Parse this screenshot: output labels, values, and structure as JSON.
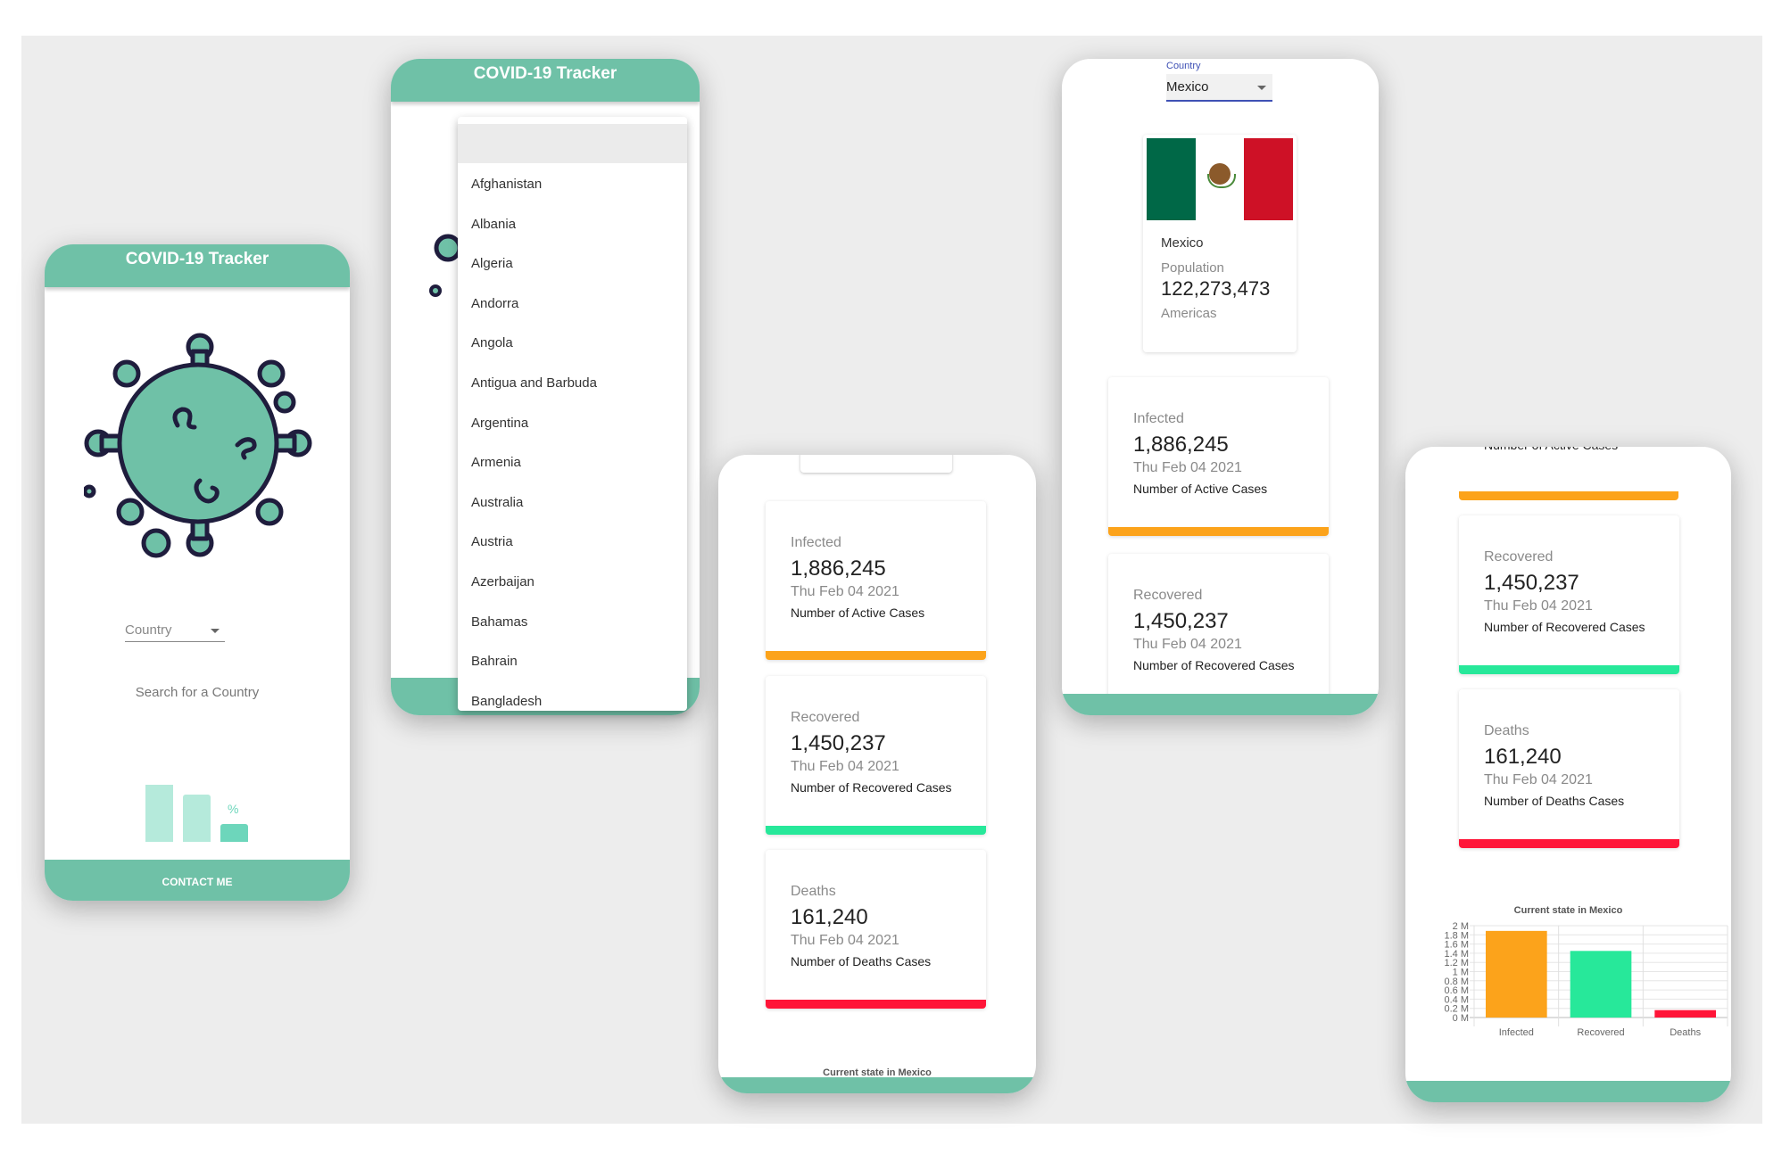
{
  "app": {
    "title": "COVID-19 Tracker",
    "footer": "CONTACT ME"
  },
  "colors": {
    "brand": "#6fc1a7",
    "infected": "#fca31b",
    "recovered": "#27e89a",
    "deaths": "#ff1538",
    "selectFocus": "#3f51b5"
  },
  "home": {
    "select_label": "Country",
    "prompt": "Search for a Country",
    "illustration": "virus-icon",
    "chart_icon": "percent-bars-icon",
    "chart_icon_symbol": "%"
  },
  "dropdown": {
    "countries": [
      "Afghanistan",
      "Albania",
      "Algeria",
      "Andorra",
      "Angola",
      "Antigua and Barbuda",
      "Argentina",
      "Armenia",
      "Australia",
      "Austria",
      "Azerbaijan",
      "Bahamas",
      "Bahrain",
      "Bangladesh"
    ]
  },
  "country": {
    "select_label": "Country",
    "selected": "Mexico",
    "name": "Mexico",
    "population_label": "Population",
    "population": "122,273,473",
    "region": "Americas"
  },
  "stats": [
    {
      "key": "infected",
      "label": "Infected",
      "value": "1,886,245",
      "date": "Thu Feb 04 2021",
      "desc": "Number of Active Cases"
    },
    {
      "key": "recovered",
      "label": "Recovered",
      "value": "1,450,237",
      "date": "Thu Feb 04 2021",
      "desc": "Number of Recovered Cases"
    },
    {
      "key": "deaths",
      "label": "Deaths",
      "value": "161,240",
      "date": "Thu Feb 04 2021",
      "desc": "Number of Deaths Cases"
    }
  ],
  "partial_texts": {
    "active_cases_cut": "Number of Active Cases"
  },
  "chart_data": {
    "type": "bar",
    "title": "Current state in Mexico",
    "categories": [
      "Infected",
      "Recovered",
      "Deaths"
    ],
    "values": [
      1886245,
      1450237,
      161240
    ],
    "colors": [
      "#fca31b",
      "#27e89a",
      "#ff1538"
    ],
    "ylim": [
      0,
      2000000
    ],
    "yticks": [
      "0 M",
      "0.2 M",
      "0.4 M",
      "0.6 M",
      "0.8 M",
      "1 M",
      "1.2 M",
      "1.4 M",
      "1.6 M",
      "1.8 M",
      "2 M"
    ],
    "xlabel": "",
    "ylabel": "",
    "grid": true,
    "legend": "none"
  }
}
